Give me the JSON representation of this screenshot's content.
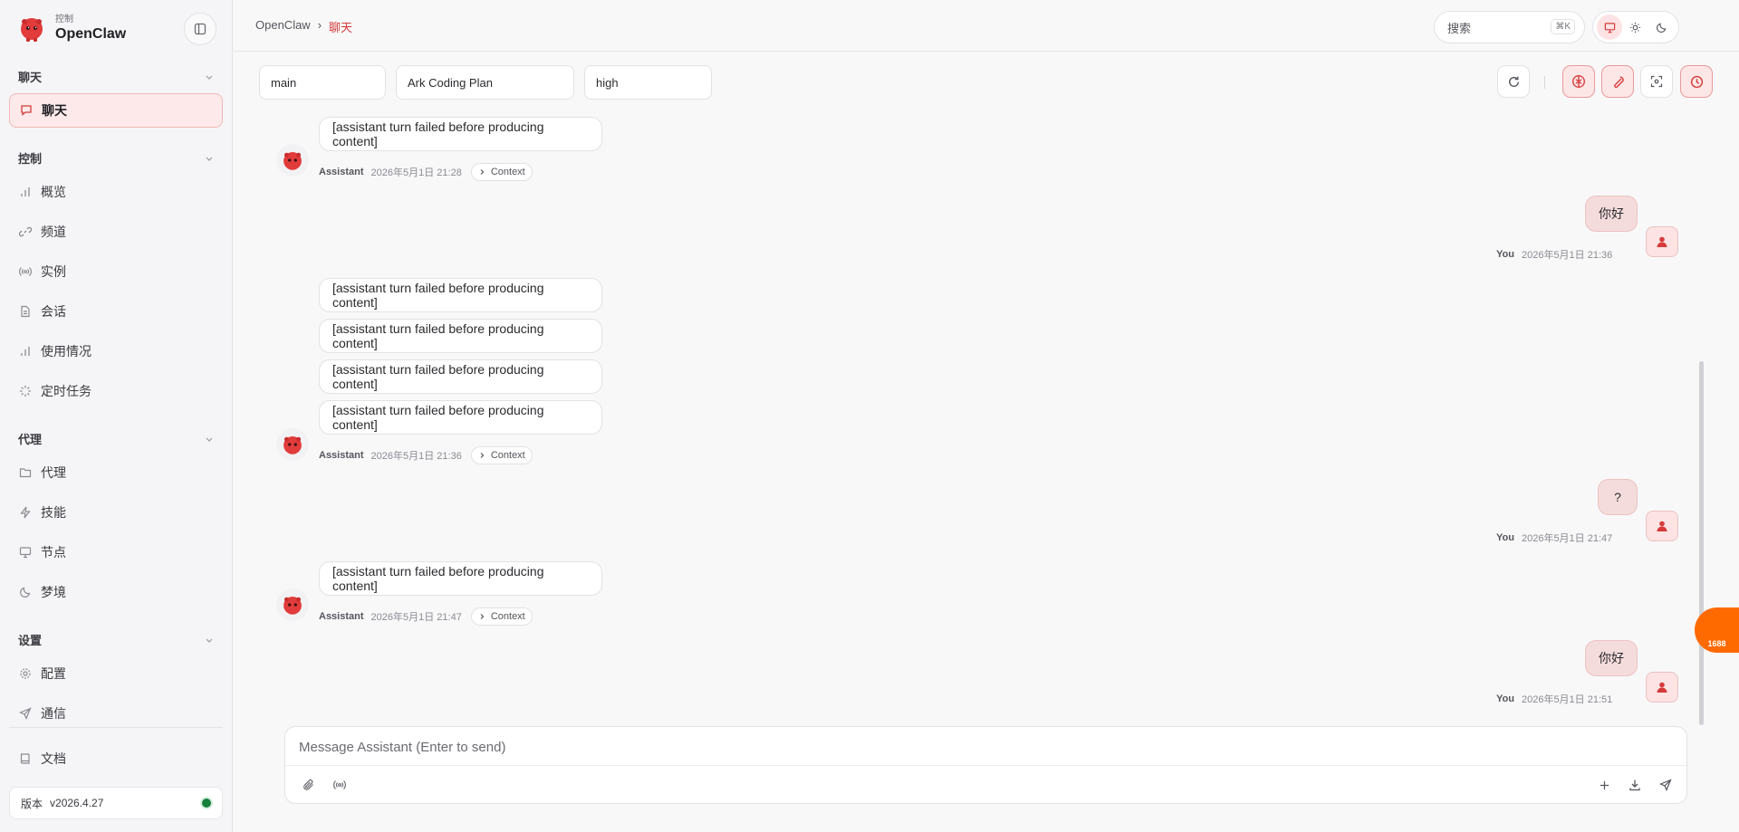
{
  "brand": {
    "sup": "控制",
    "name": "OpenClaw"
  },
  "sidebar": {
    "sections": [
      {
        "title": "聊天"
      },
      {
        "title": "控制"
      },
      {
        "title": "代理"
      },
      {
        "title": "设置"
      }
    ],
    "chat_items": [
      {
        "label": "聊天",
        "icon": "message-icon",
        "active": true
      }
    ],
    "control_items": [
      {
        "label": "概览",
        "icon": "bar-chart-icon"
      },
      {
        "label": "频道",
        "icon": "link-icon"
      },
      {
        "label": "实例",
        "icon": "broadcast-icon"
      },
      {
        "label": "会话",
        "icon": "file-icon"
      },
      {
        "label": "使用情况",
        "icon": "bar-chart-icon"
      },
      {
        "label": "定时任务",
        "icon": "loader-icon"
      }
    ],
    "agent_items": [
      {
        "label": "代理",
        "icon": "folder-icon"
      },
      {
        "label": "技能",
        "icon": "zap-icon"
      },
      {
        "label": "节点",
        "icon": "monitor-icon"
      },
      {
        "label": "梦境",
        "icon": "moon-icon"
      }
    ],
    "settings_items": [
      {
        "label": "配置",
        "icon": "gear-icon"
      },
      {
        "label": "通信",
        "icon": "send-icon"
      }
    ],
    "docs": {
      "label": "文档",
      "icon": "book-icon"
    },
    "version": {
      "label": "版本",
      "value": "v2026.4.27",
      "status_color": "#15803d"
    }
  },
  "header": {
    "breadcrumb": {
      "root": "OpenClaw",
      "sep": "›",
      "current": "聊天"
    },
    "search": {
      "placeholder": "搜索",
      "shortcut": "⌘K"
    },
    "theme": {
      "selected": "monitor-icon",
      "options": [
        "monitor-icon",
        "sun-icon",
        "moon-icon"
      ]
    }
  },
  "controls": {
    "agent": "main",
    "model": "Ark Coding Plan",
    "thinking": "high",
    "tools": [
      "refresh-icon",
      "brain-icon",
      "wrench-icon",
      "focus-icon",
      "clock-icon"
    ]
  },
  "messages": [
    {
      "role": "assistant",
      "bubbles": [
        "[assistant turn failed before producing content]"
      ],
      "who": "Assistant",
      "time": "2026年5月1日 21:28",
      "context": "Context"
    },
    {
      "role": "user",
      "bubbles": [
        "你好"
      ],
      "who": "You",
      "time": "2026年5月1日 21:36"
    },
    {
      "role": "assistant",
      "bubbles": [
        "[assistant turn failed before producing content]",
        "[assistant turn failed before producing content]",
        "[assistant turn failed before producing content]",
        "[assistant turn failed before producing content]"
      ],
      "who": "Assistant",
      "time": "2026年5月1日 21:36",
      "context": "Context"
    },
    {
      "role": "user",
      "bubbles": [
        "?"
      ],
      "who": "You",
      "time": "2026年5月1日 21:47"
    },
    {
      "role": "assistant",
      "bubbles": [
        "[assistant turn failed before producing content]"
      ],
      "who": "Assistant",
      "time": "2026年5月1日 21:47",
      "context": "Context"
    },
    {
      "role": "user",
      "bubbles": [
        "你好"
      ],
      "who": "You",
      "time": "2026年5月1日 21:51"
    }
  ],
  "composer": {
    "placeholder": "Message Assistant (Enter to send)"
  },
  "widget": {
    "label": "1688"
  },
  "colors": {
    "accent": "#d63a3a",
    "accent_bg": "#fde9e9",
    "user_bubble": "#f5dcdc"
  }
}
